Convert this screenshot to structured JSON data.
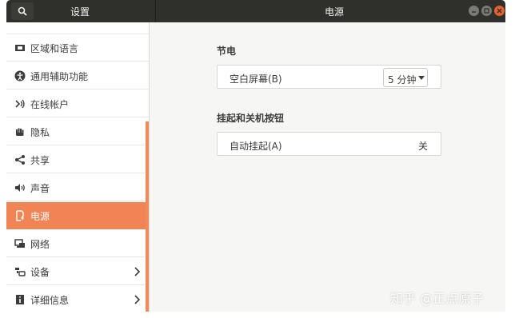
{
  "header": {
    "left_title": "设置",
    "right_title": "电源"
  },
  "sidebar": {
    "partial_item": "",
    "items": [
      {
        "label": "区域和语言",
        "icon": "region-flag-icon"
      },
      {
        "label": "通用辅助功能",
        "icon": "accessibility-icon"
      },
      {
        "label": "在线帐户",
        "icon": "online-accounts-icon"
      },
      {
        "label": "隐私",
        "icon": "privacy-hand-icon"
      },
      {
        "label": "共享",
        "icon": "share-icon"
      },
      {
        "label": "声音",
        "icon": "speaker-icon"
      },
      {
        "label": "电源",
        "icon": "power-icon",
        "active": true
      },
      {
        "label": "网络",
        "icon": "network-icon"
      },
      {
        "label": "设备",
        "icon": "devices-icon",
        "chevron": true
      },
      {
        "label": "详细信息",
        "icon": "info-icon",
        "chevron": true
      }
    ]
  },
  "main": {
    "power_saving": {
      "title": "节电",
      "blank_screen_label": "空白屏幕(B)",
      "blank_screen_value": "5 分钟"
    },
    "suspend": {
      "title": "挂起和关机按钮",
      "auto_suspend_label": "自动挂起(A)",
      "auto_suspend_value": "关"
    }
  },
  "watermark": "知乎 @正点原子",
  "colors": {
    "accent": "#f08454",
    "header_bg": "#2f2f2c",
    "close_button": "#e8612c"
  }
}
